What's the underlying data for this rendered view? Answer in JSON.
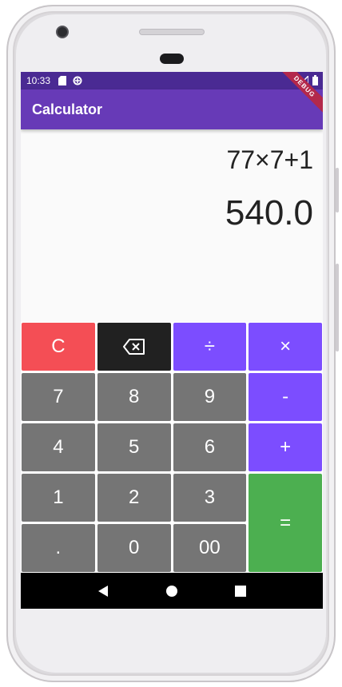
{
  "status_bar": {
    "time": "10:33",
    "icons": [
      "sd-card-icon",
      "data-saver-icon",
      "wifi-icon",
      "battery-icon"
    ]
  },
  "app_bar": {
    "title": "Calculator",
    "debug_banner": "DEBUG"
  },
  "display": {
    "expression": "77×7+1",
    "result": "540.0"
  },
  "keypad": {
    "clear": "C",
    "divide": "÷",
    "multiply": "×",
    "seven": "7",
    "eight": "8",
    "nine": "9",
    "minus": "-",
    "four": "4",
    "five": "5",
    "six": "6",
    "plus": "+",
    "one": "1",
    "two": "2",
    "three": "3",
    "equals": "=",
    "decimal": ".",
    "zero": "0",
    "double_zero": "00"
  },
  "colors": {
    "app_bar": "#673ab7",
    "status_bar": "#4a2a93",
    "operator": "#7c4dff",
    "number": "#757575",
    "clear": "#f44e55",
    "backspace": "#212121",
    "equals": "#4caf50"
  }
}
